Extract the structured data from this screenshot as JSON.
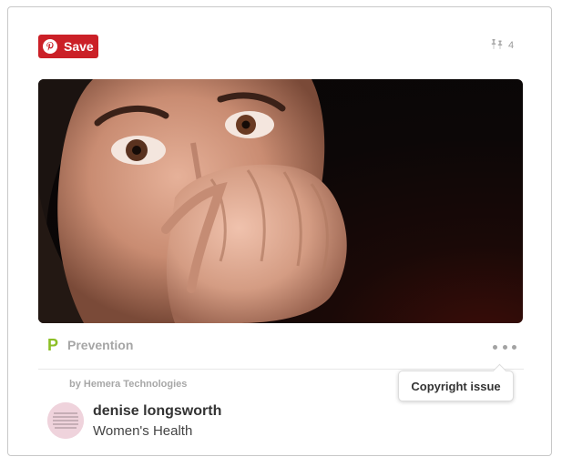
{
  "header": {
    "save_label": "Save",
    "repin_count": "4",
    "icons": {
      "save": "pinterest-logo-icon",
      "repin": "pushpin-icon"
    }
  },
  "pin": {
    "image_description_icon": "photo",
    "source": {
      "name": "Prevention",
      "logo_icon": "prevention-logo-icon",
      "logo_color": "#8cbf26"
    },
    "more_icon": "ellipsis-icon",
    "credit": "by Hemera Technologies",
    "menu": {
      "copyright_label": "Copyright issue"
    }
  },
  "pinner": {
    "user_name": "denise longsworth",
    "board_name": "Women's Health"
  },
  "colors": {
    "save_button": "#cb2027",
    "muted_text": "#a6a6a6"
  }
}
